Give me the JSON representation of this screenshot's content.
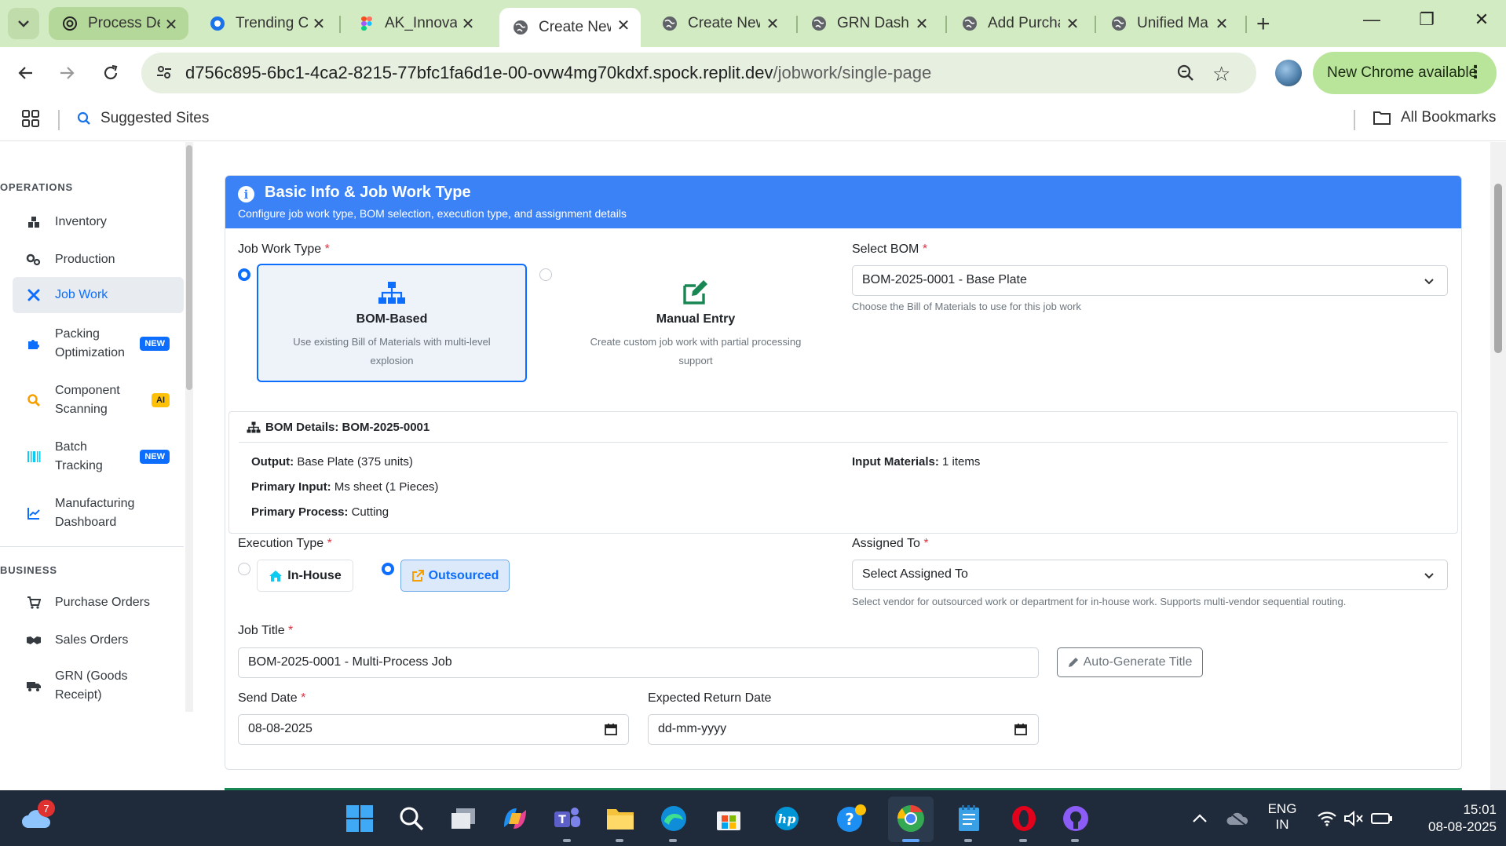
{
  "browser": {
    "tabs": [
      {
        "title": "Process Design",
        "icon": "openai-icon"
      },
      {
        "title": "Trending Co",
        "icon": "chrome-circle-icon"
      },
      {
        "title": "AK_Innovat",
        "icon": "figma-icon"
      },
      {
        "title": "Create New",
        "icon": "globe-icon",
        "active": true
      },
      {
        "title": "Create New",
        "icon": "globe-icon"
      },
      {
        "title": "GRN Dashb",
        "icon": "globe-icon"
      },
      {
        "title": "Add Purcha",
        "icon": "globe-icon"
      },
      {
        "title": "Unified Ma",
        "icon": "globe-icon"
      }
    ],
    "url_host": "d756c895-6bc1-4ca2-8215-77bfc1fa6d1e-00-ovw4mg70kdxf.spock.replit.dev",
    "url_path": "/jobwork/single-page",
    "new_chrome_label": "New Chrome available",
    "bookmarks": {
      "suggested_label": "Suggested Sites",
      "all_label": "All Bookmarks"
    }
  },
  "sidebar": {
    "sections": [
      {
        "title": "OPERATIONS",
        "items": [
          {
            "label": "Inventory",
            "icon": "warehouse-icon"
          },
          {
            "label": "Production",
            "icon": "gears-icon"
          },
          {
            "label": "Job Work",
            "icon": "tools-icon",
            "active": true
          },
          {
            "label": "Packing Optimization",
            "line1": "Packing",
            "line2": "Optimization",
            "icon": "puzzle-icon",
            "badge": "NEW"
          },
          {
            "label": "Component Scanning",
            "line1": "Component",
            "line2": "Scanning",
            "icon": "search-icon",
            "badge": "AI"
          },
          {
            "label": "Batch Tracking",
            "line1": "Batch",
            "line2": "Tracking",
            "icon": "barcode-icon",
            "badge": "NEW"
          },
          {
            "label": "Manufacturing Dashboard",
            "line1": "Manufacturing",
            "line2": "Dashboard",
            "icon": "chart-line-icon"
          }
        ]
      },
      {
        "title": "BUSINESS",
        "items": [
          {
            "label": "Purchase Orders",
            "icon": "cart-icon"
          },
          {
            "label": "Sales Orders",
            "icon": "handshake-icon"
          },
          {
            "label": "GRN (Goods Receipt)",
            "line1": "GRN (Goods",
            "line2": "Receipt)",
            "icon": "truck-icon"
          }
        ]
      }
    ]
  },
  "card": {
    "title": "Basic Info & Job Work Type",
    "subtitle": "Configure job work type, BOM selection, execution type, and assignment details",
    "job_work_type": {
      "label": "Job Work Type",
      "options": [
        {
          "title": "BOM-Based",
          "desc_line1": "Use existing Bill of Materials with multi-level",
          "desc_line2": "explosion",
          "selected": true,
          "icon": "sitemap-icon"
        },
        {
          "title": "Manual Entry",
          "desc_line1": "Create custom job work with partial processing",
          "desc_line2": "support",
          "selected": false,
          "icon": "edit-icon"
        }
      ]
    },
    "select_bom": {
      "label": "Select BOM",
      "value": "BOM-2025-0001 - Base Plate",
      "help": "Choose the Bill of Materials to use for this job work"
    },
    "bom_details": {
      "header": "BOM Details: BOM-2025-0001",
      "output_label": "Output:",
      "output_value": "Base Plate (375 units)",
      "primary_input_label": "Primary Input:",
      "primary_input_value": "Ms sheet (1 Pieces)",
      "primary_process_label": "Primary Process:",
      "primary_process_value": "Cutting",
      "input_materials_label": "Input Materials:",
      "input_materials_value": "1 items"
    },
    "execution_type": {
      "label": "Execution Type",
      "options": [
        {
          "label": "In-House",
          "selected": false,
          "icon": "home-icon"
        },
        {
          "label": "Outsourced",
          "selected": true,
          "icon": "external-link-icon"
        }
      ]
    },
    "assigned_to": {
      "label": "Assigned To",
      "value": "Select Assigned To",
      "help": "Select vendor for outsourced work or department for in-house work. Supports multi-vendor sequential routing."
    },
    "job_title": {
      "label": "Job Title",
      "value": "BOM-2025-0001 - Multi-Process Job",
      "auto_button": "Auto-Generate Title"
    },
    "send_date": {
      "label": "Send Date",
      "value": "08-08-2025"
    },
    "expected_return_date": {
      "label": "Expected Return Date",
      "value": "dd-mm-yyyy"
    }
  },
  "taskbar": {
    "weather_badge": "7",
    "lang_line1": "ENG",
    "lang_line2": "IN",
    "time": "15:01",
    "date": "08-08-2025",
    "apps": [
      "start-icon",
      "search-icon",
      "task-view-icon",
      "copilot-icon",
      "teams-icon",
      "file-explorer-icon",
      "edge-icon",
      "store-icon",
      "hp-icon",
      "help-icon",
      "chrome-icon",
      "notepad-icon",
      "opera-icon",
      "github-icon"
    ]
  },
  "colors": {
    "chrome_frame": "#d3ebc2",
    "card_header": "#3b82f6",
    "primary": "#0d6efd",
    "required": "#dc3545",
    "taskbar": "#1f2a3a"
  }
}
